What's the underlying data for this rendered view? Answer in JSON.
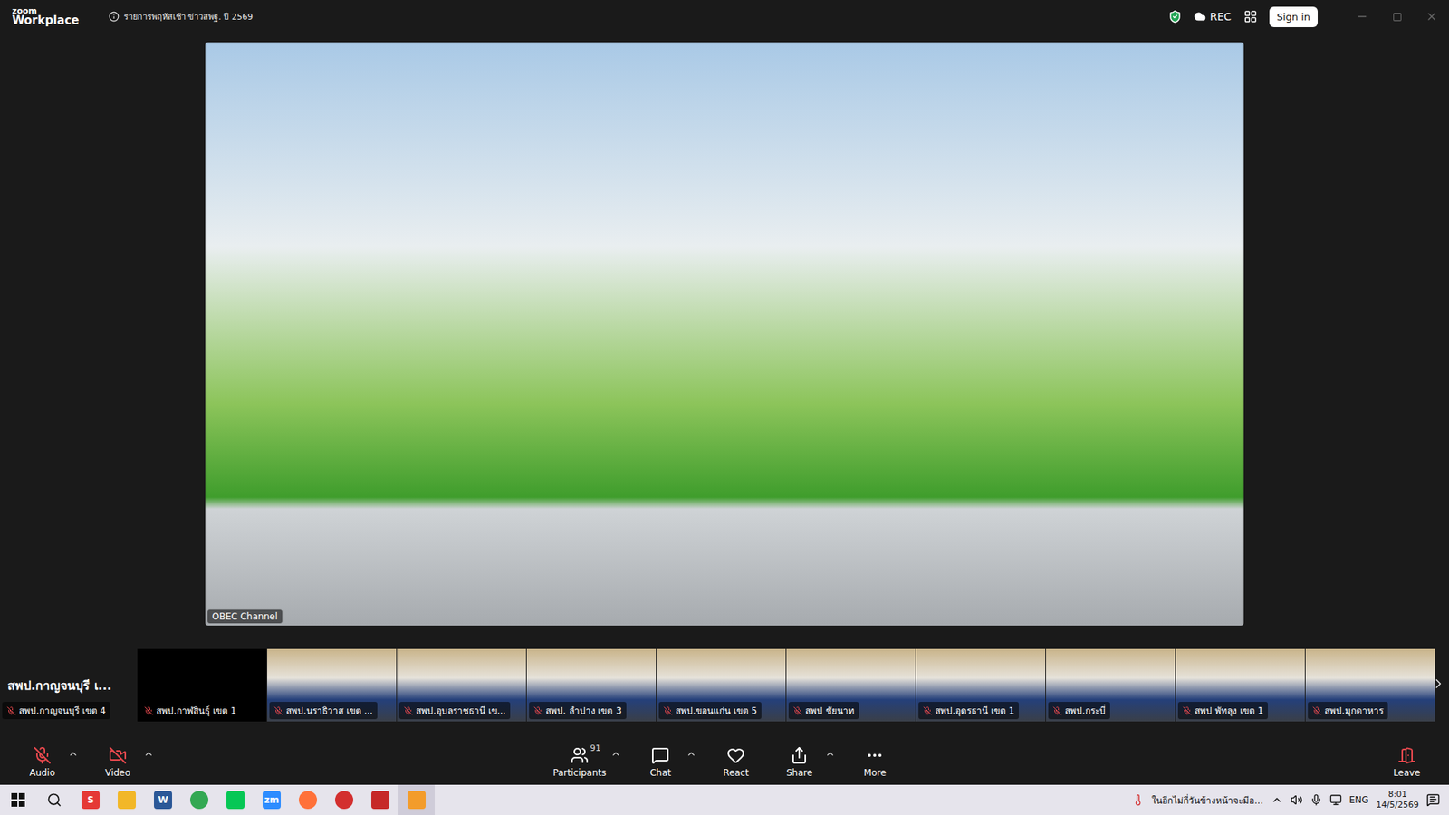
{
  "window": {
    "title": "รายการพฤหัสเช้า ข่าวสพฐ. ปี 2569"
  },
  "logo": {
    "brand": "zoom",
    "product": "Workplace"
  },
  "top_bar": {
    "encrypted": true,
    "recording": true,
    "rec_label": "REC",
    "sign_in": "Sign in"
  },
  "main_video": {
    "name_label": "OBEC Channel",
    "video_on": true
  },
  "gallery": {
    "speaker": {
      "name": "สพป.กาญจนบุรี เ...",
      "label": "สพป.กาญจนบุรี เขต 4",
      "muted": true
    },
    "tiles": [
      {
        "label": "สพป.กาฬสินธุ์ เขต 1",
        "muted": true,
        "video_on": false
      },
      {
        "label": "สพป.นราธิวาส เขต ...",
        "muted": true,
        "video_on": true
      },
      {
        "label": "สพป.อุบลราชธานี เข...",
        "muted": true,
        "video_on": true
      },
      {
        "label": "สพป. ลำปาง เขต 3",
        "muted": true,
        "video_on": true
      },
      {
        "label": "สพป.ขอนแก่น เขต 5",
        "muted": true,
        "video_on": true
      },
      {
        "label": "สพป ชัยนาท",
        "muted": true,
        "video_on": true
      },
      {
        "label": "สพป.อุดรธานี เขต 1",
        "muted": true,
        "video_on": true
      },
      {
        "label": "สพป.กระบี่",
        "muted": true,
        "video_on": true
      },
      {
        "label": "สพป พัทลุง เขต 1",
        "muted": true,
        "video_on": true
      },
      {
        "label": "สพป.มุกดาหาร",
        "muted": true,
        "video_on": true
      }
    ]
  },
  "toolbar": {
    "items": [
      {
        "label": "Audio",
        "kind": "audio",
        "off": true,
        "menu": true,
        "count": ""
      },
      {
        "label": "Video",
        "kind": "video",
        "off": true,
        "menu": true,
        "count": ""
      },
      {
        "label": "Participants",
        "kind": "participants",
        "off": false,
        "menu": true,
        "count": "91"
      },
      {
        "label": "Chat",
        "kind": "chat",
        "off": false,
        "menu": true,
        "count": ""
      },
      {
        "label": "React",
        "kind": "react",
        "off": false,
        "menu": false,
        "count": ""
      },
      {
        "label": "Share",
        "kind": "share",
        "off": false,
        "menu": true,
        "count": ""
      },
      {
        "label": "More",
        "kind": "more",
        "off": false,
        "menu": false,
        "count": ""
      }
    ],
    "leave": {
      "label": "Leave"
    }
  },
  "taskbar": {
    "apps": [
      {
        "kind": "letter",
        "glyph": "S",
        "color": "#e53935",
        "active": false
      },
      {
        "kind": "folder",
        "glyph": "",
        "color": "#f2b728",
        "active": false
      },
      {
        "kind": "letter",
        "glyph": "W",
        "color": "#2b5797",
        "active": false
      },
      {
        "kind": "chrome",
        "glyph": "",
        "color": "#34a853",
        "active": false
      },
      {
        "kind": "line",
        "glyph": "",
        "color": "#06c755",
        "active": false
      },
      {
        "kind": "letter",
        "glyph": "zm",
        "color": "#2d8cff",
        "active": false
      },
      {
        "kind": "firefox",
        "glyph": "",
        "color": "#ff7139",
        "active": false
      },
      {
        "kind": "record",
        "glyph": "",
        "color": "#d32f2f",
        "active": false
      },
      {
        "kind": "acrobat",
        "glyph": "",
        "color": "#c62828",
        "active": false
      },
      {
        "kind": "app",
        "glyph": "",
        "color": "#f39c2b",
        "active": true
      }
    ],
    "tray": {
      "notification": "ในอีกไม่กี่วันข้างหน้าจะมีอ...",
      "language": "ENG",
      "time": "8:01",
      "date": "14/5/2569"
    }
  }
}
